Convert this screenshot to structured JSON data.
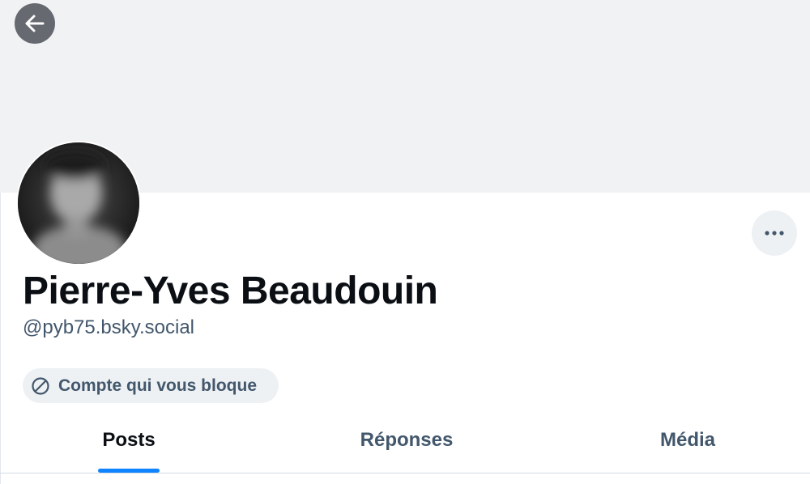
{
  "profile": {
    "display_name": "Pierre-Yves Beaudouin",
    "handle": "@pyb75.bsky.social"
  },
  "blocked_notice": {
    "label": "Compte qui vous bloque",
    "icon": "blocked-icon"
  },
  "controls": {
    "back_icon": "arrow-left-icon",
    "more_icon": "ellipsis-icon"
  },
  "tabs": [
    {
      "label": "Posts",
      "active": true
    },
    {
      "label": "Réponses",
      "active": false
    },
    {
      "label": "Média",
      "active": false
    }
  ],
  "colors": {
    "banner": "#f1f2f4",
    "accent": "#1083fe",
    "muted_text": "#42576c",
    "primary_text": "#0b0f14",
    "pill_background": "#eef1f4"
  }
}
